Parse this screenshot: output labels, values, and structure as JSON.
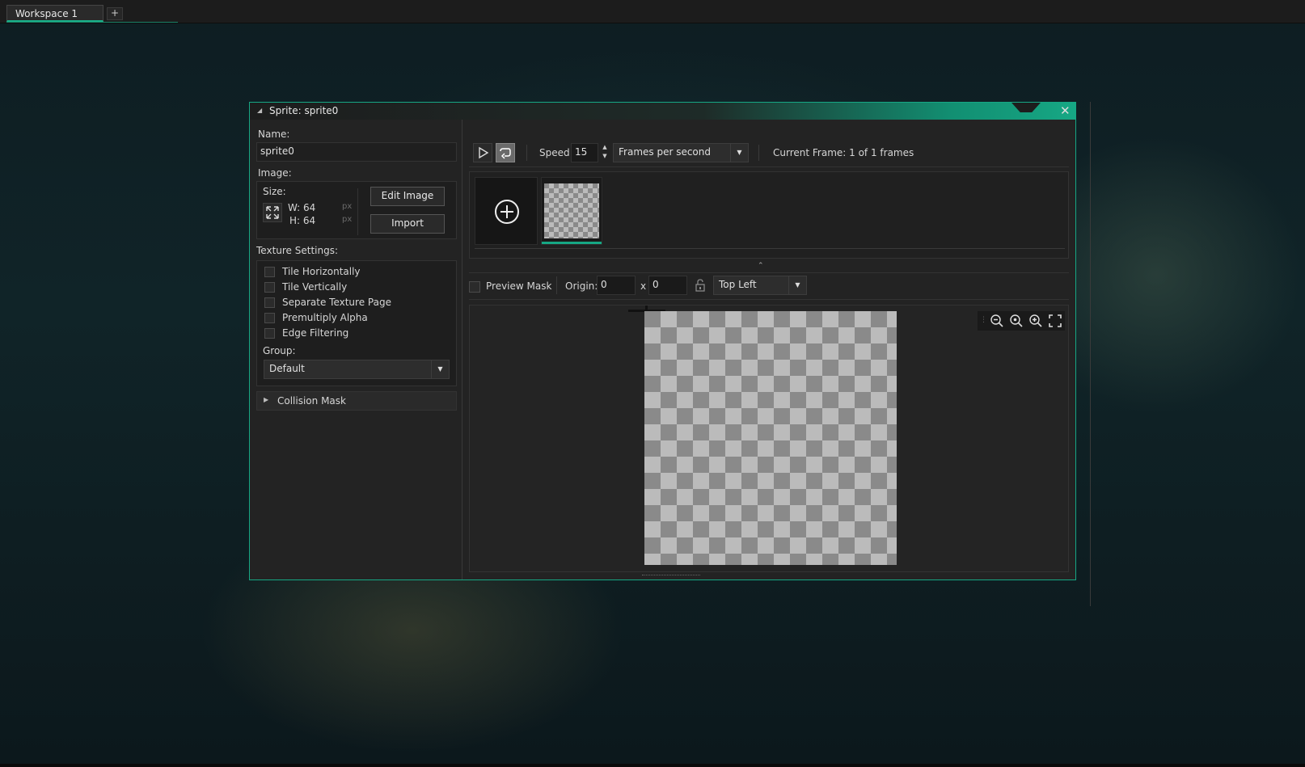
{
  "workspace": {
    "tab_label": "Workspace 1",
    "add_tab": "+"
  },
  "window": {
    "title": "Sprite: sprite0",
    "close_glyph": "✕"
  },
  "left": {
    "name_label": "Name:",
    "name_value": "sprite0",
    "image_label": "Image:",
    "size_label": "Size:",
    "width_text": "W: 64",
    "height_text": "H: 64",
    "unit": "px",
    "edit_image_button": "Edit Image",
    "import_button": "Import",
    "texture_settings_label": "Texture Settings:",
    "texture_options": [
      {
        "label": "Tile Horizontally",
        "checked": false
      },
      {
        "label": "Tile Vertically",
        "checked": false
      },
      {
        "label": "Separate Texture Page",
        "checked": false
      },
      {
        "label": "Premultiply Alpha",
        "checked": false
      },
      {
        "label": "Edge Filtering",
        "checked": false
      }
    ],
    "group_label": "Group:",
    "group_value": "Default",
    "collision_mask_label": "Collision Mask"
  },
  "right": {
    "speed_label": "Speed:",
    "speed_value": "15",
    "speed_unit": "Frames per second",
    "current_frame_text": "Current Frame: 1 of 1 frames",
    "preview_mask_label": "Preview Mask",
    "origin_label": "Origin:",
    "origin_x": "0",
    "origin_sep": "x",
    "origin_y": "0",
    "origin_preset": "Top Left"
  },
  "icons": {
    "play": "play-icon",
    "loop": "loop-icon",
    "add_frame": "add-frame-icon",
    "resize": "resize-icon",
    "lock": "unlock-icon",
    "zoom_out": "zoom-out-icon",
    "zoom_reset": "zoom-reset-icon",
    "zoom_in": "zoom-in-icon",
    "fit": "fit-to-screen-icon"
  },
  "colors": {
    "accent": "#16a784",
    "window_bg": "#232323",
    "panel_bg": "#1e1e1e"
  }
}
